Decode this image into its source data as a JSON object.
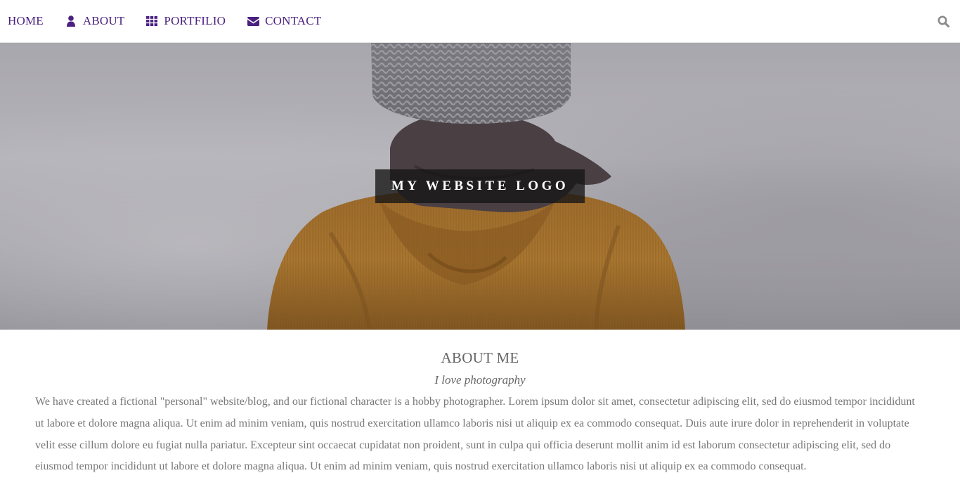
{
  "nav": {
    "items": [
      {
        "label": "HOME",
        "icon": ""
      },
      {
        "label": "ABOUT",
        "icon": "user-icon"
      },
      {
        "label": "PORTFILIO",
        "icon": "grid-icon"
      },
      {
        "label": "CONTACT",
        "icon": "envelope-icon"
      }
    ],
    "search_icon": "search-icon"
  },
  "hero": {
    "logo_text": "MY WEBSITE LOGO"
  },
  "about": {
    "title": "ABOUT ME",
    "subtitle": "I love photography",
    "body": "We have created a fictional \"personal\" website/blog, and our fictional character is a hobby photographer. Lorem ipsum dolor sit amet, consectetur adipiscing elit, sed do eiusmod tempor incididunt ut labore et dolore magna aliqua. Ut enim ad minim veniam, quis nostrud exercitation ullamco laboris nisi ut aliquip ex ea commodo consequat. Duis aute irure dolor in reprehenderit in voluptate velit esse cillum dolore eu fugiat nulla pariatur. Excepteur sint occaecat cupidatat non proident, sunt in culpa qui officia deserunt mollit anim id est laborum consectetur adipiscing elit, sed do eiusmod tempor incididunt ut labore et dolore magna aliqua. Ut enim ad minim veniam, quis nostrud exercitation ullamco laboris nisi ut aliquip ex ea commodo consequat."
  },
  "colors": {
    "nav_text": "#4a2080",
    "body_text": "#777777",
    "heading_text": "#666666",
    "logo_bg": "#141414",
    "logo_text": "#ffffff"
  }
}
